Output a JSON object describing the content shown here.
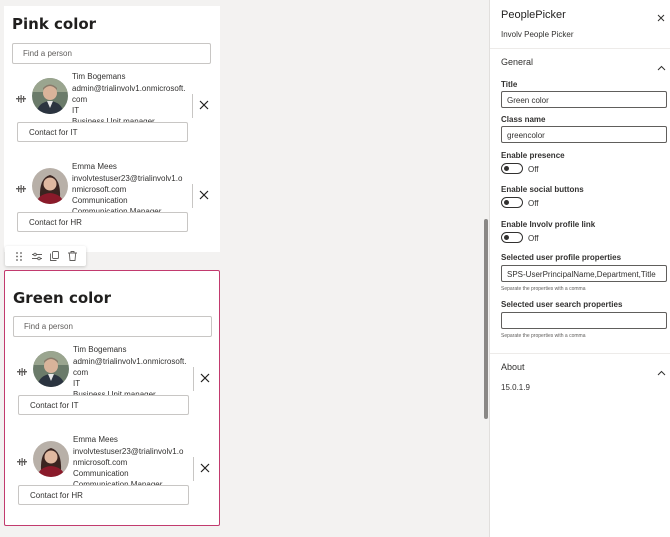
{
  "webparts": [
    {
      "title": "Pink color",
      "search_placeholder": "Find a person",
      "people": [
        {
          "name": "Tim Bogemans",
          "email_line1": "admin@trialinvolv1.onmicrosoft.",
          "email_line2": "com",
          "department": "IT",
          "job": "Business Unit manager",
          "contact": "Contact for IT"
        },
        {
          "name": "Emma Mees",
          "email_line1": "involvtestuser23@trialinvolv1.o",
          "email_line2": "nmicrosoft.com",
          "department": "Communication",
          "job": "Communication Manager",
          "contact": "Contact for HR"
        }
      ]
    },
    {
      "title": "Green color",
      "search_placeholder": "Find a person",
      "people": [
        {
          "name": "Tim Bogemans",
          "email_line1": "admin@trialinvolv1.onmicrosoft.",
          "email_line2": "com",
          "department": "IT",
          "job": "Business Unit manager",
          "contact": "Contact for IT"
        },
        {
          "name": "Emma Mees",
          "email_line1": "involvtestuser23@trialinvolv1.o",
          "email_line2": "nmicrosoft.com",
          "department": "Communication",
          "job": "Communication Manager",
          "contact": "Contact for HR"
        }
      ]
    }
  ],
  "toolbar": {
    "icons": [
      "drag-handle-icon",
      "settings-sliders-icon",
      "duplicate-icon",
      "delete-icon"
    ]
  },
  "pane": {
    "title": "PeoplePicker",
    "description": "Involv People Picker",
    "general_label": "General",
    "fields": {
      "title_label": "Title",
      "title_value": "Green color",
      "class_label": "Class name",
      "class_value": "greencolor",
      "presence_label": "Enable presence",
      "presence_state": "Off",
      "social_label": "Enable social buttons",
      "social_state": "Off",
      "profile_link_label": "Enable Involv profile link",
      "profile_link_state": "Off",
      "profile_props_label": "Selected user profile properties",
      "profile_props_value": "SPS-UserPrincipalName,Department,Title",
      "profile_props_hint": "Separate the properties with a comma",
      "search_props_label": "Selected user search properties",
      "search_props_value": "",
      "search_props_hint": "Separate the properties with a comma"
    },
    "about_label": "About",
    "version": "15.0.1.9"
  },
  "colors": {
    "selected_border": "#c23a6e",
    "canvas_bg": "#f3f2f1"
  }
}
